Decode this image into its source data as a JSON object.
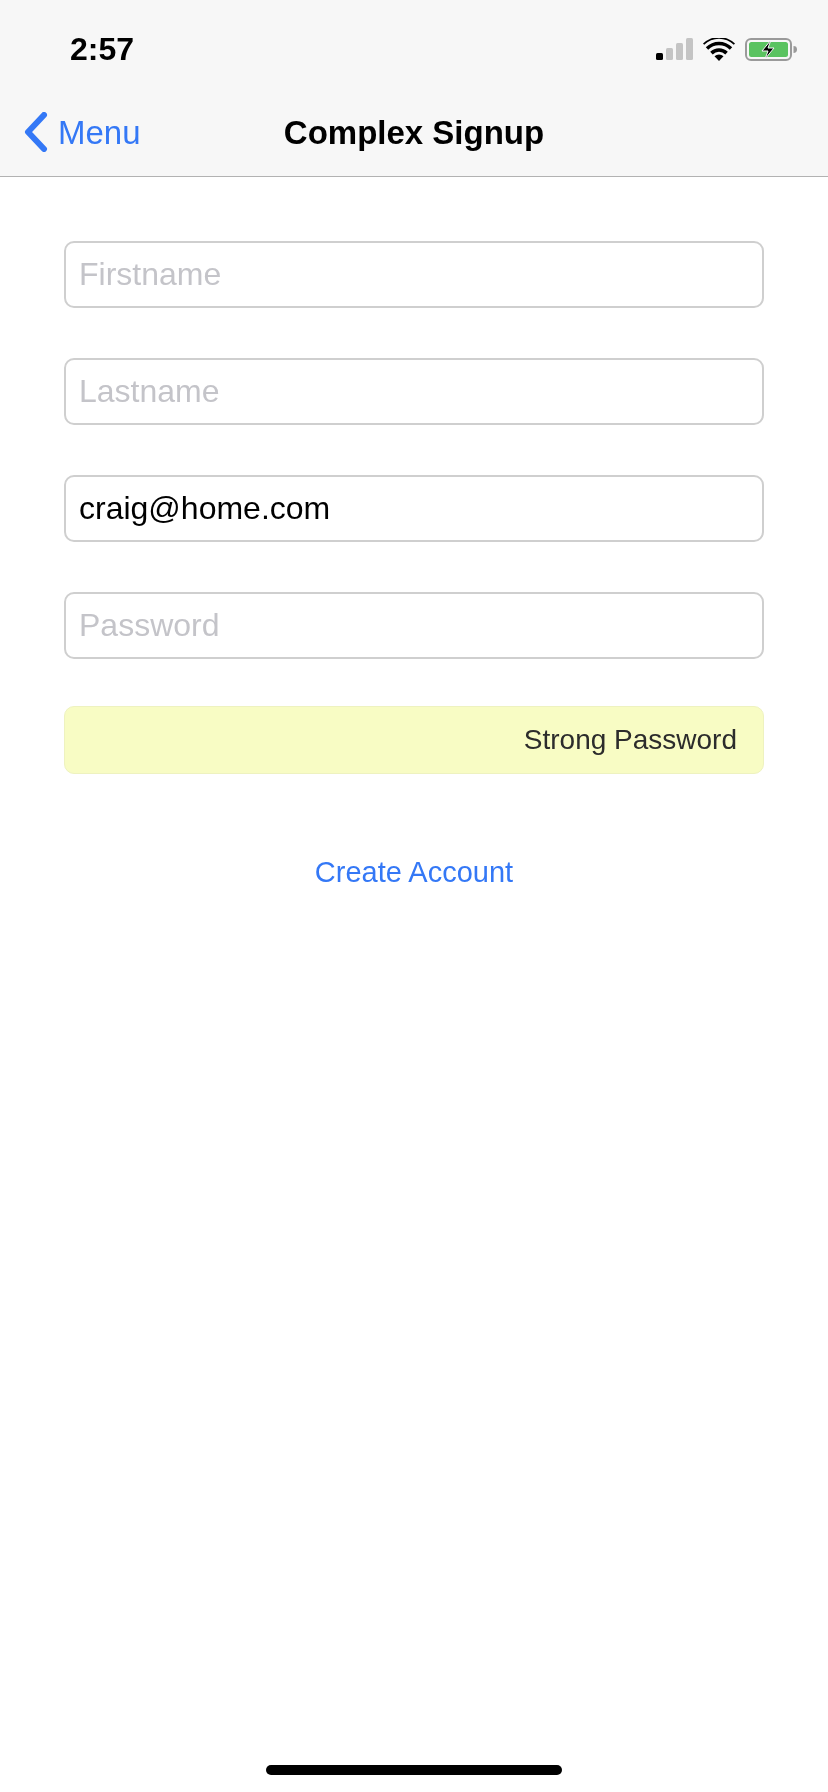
{
  "status_bar": {
    "time": "2:57"
  },
  "nav_bar": {
    "back_label": "Menu",
    "title": "Complex Signup"
  },
  "fields": [
    {
      "placeholder": "Firstname"
    },
    {
      "placeholder": "Lastname"
    },
    {
      "value": "craig@home.com"
    },
    {
      "placeholder": "Password"
    }
  ],
  "strength": {
    "label": "Strong Password"
  },
  "create_button": {
    "label": "Create Account"
  }
}
